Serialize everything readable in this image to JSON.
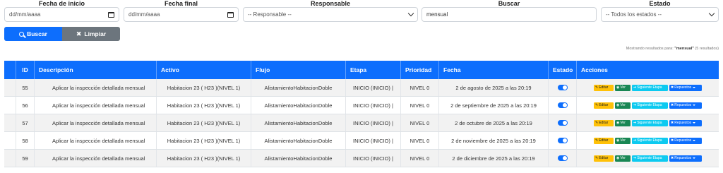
{
  "filters": {
    "fecha_inicio": {
      "label": "Fecha de inicio",
      "value": "dd/mm/aaaa"
    },
    "fecha_final": {
      "label": "Fecha final",
      "value": "dd/mm/aaaa"
    },
    "responsable": {
      "label": "Responsable",
      "value": "-- Responsable --"
    },
    "buscar": {
      "label": "Buscar",
      "value": "mensual"
    },
    "estado": {
      "label": "Estado",
      "value": "-- Todos los estados --"
    }
  },
  "buttons": {
    "search": "Buscar",
    "clear": "Limpiar"
  },
  "result_note": {
    "prefix": "Mostrando resultados para:",
    "term": "\"mensual\"",
    "count": "(5 resultados)"
  },
  "table": {
    "headers": {
      "id": "ID",
      "descripcion": "Descripción",
      "activo": "Activo",
      "flujo": "Flujo",
      "etapa": "Etapa",
      "prioridad": "Prioridad",
      "fecha": "Fecha",
      "estado": "Estado",
      "acciones": "Acciones"
    },
    "action_labels": {
      "edit": "Editar",
      "view": "Ver",
      "next": "Siguiente Etapa",
      "repuestos": "Repuestos"
    },
    "rows": [
      {
        "id": "55",
        "descripcion": "Aplicar la inspección detallada mensual",
        "activo": "Habitacion 23 ( H23 )(NIVEL 1)",
        "flujo": "AlistamientoHabitacionDoble",
        "etapa": "INICIO (INICIO) |",
        "prioridad": "NIVEL 0",
        "fecha": "2 de agosto de 2025 a las 20:19",
        "estado": true
      },
      {
        "id": "56",
        "descripcion": "Aplicar la inspección detallada mensual",
        "activo": "Habitacion 23 ( H23 )(NIVEL 1)",
        "flujo": "AlistamientoHabitacionDoble",
        "etapa": "INICIO (INICIO) |",
        "prioridad": "NIVEL 0",
        "fecha": "2 de septiembre de 2025 a las 20:19",
        "estado": true
      },
      {
        "id": "57",
        "descripcion": "Aplicar la inspección detallada mensual",
        "activo": "Habitacion 23 ( H23 )(NIVEL 1)",
        "flujo": "AlistamientoHabitacionDoble",
        "etapa": "INICIO (INICIO) |",
        "prioridad": "NIVEL 0",
        "fecha": "2 de octubre de 2025 a las 20:19",
        "estado": true
      },
      {
        "id": "58",
        "descripcion": "Aplicar la inspección detallada mensual",
        "activo": "Habitacion 23 ( H23 )(NIVEL 1)",
        "flujo": "AlistamientoHabitacionDoble",
        "etapa": "INICIO (INICIO) |",
        "prioridad": "NIVEL 0",
        "fecha": "2 de noviembre de 2025 a las 20:19",
        "estado": true
      },
      {
        "id": "59",
        "descripcion": "Aplicar la inspección detallada mensual",
        "activo": "Habitacion 23 ( H23 )(NIVEL 1)",
        "flujo": "AlistamientoHabitacionDoble",
        "etapa": "INICIO (INICIO) |",
        "prioridad": "NIVEL 0",
        "fecha": "2 de diciembre de 2025 a las 20:19",
        "estado": true
      }
    ]
  },
  "colors": {
    "primary": "#0d6efd",
    "secondary": "#6c757d",
    "warning": "#ffc107",
    "success": "#198754",
    "info": "#0dcaf0"
  }
}
